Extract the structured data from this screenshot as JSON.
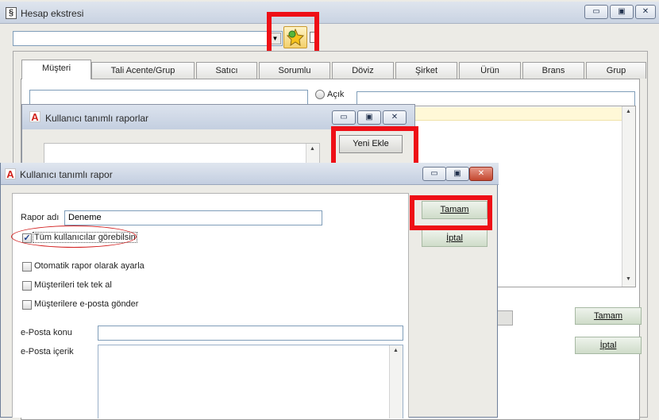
{
  "main_window": {
    "title": "Hesap ekstresi",
    "tabs": [
      "Müşteri",
      "Tali Acente/Grup",
      "Satıcı",
      "Sorumlu",
      "Döviz",
      "Şirket",
      "Ürün",
      "Brans",
      "Grup"
    ],
    "radio_label": "Açık",
    "ok_button": "Tamam",
    "cancel_button": "İptal"
  },
  "mid_dialog": {
    "title": "Kullanıcı tanımlı raporlar",
    "add_button": "Yeni Ekle"
  },
  "report_dialog": {
    "title": "Kullanıcı tanımlı rapor",
    "report_name_label": "Rapor adı",
    "report_name_value": "Deneme",
    "checkboxes": [
      {
        "label": "Tüm kullanıcılar görebilsin",
        "checked": true
      },
      {
        "label": "Otomatik rapor olarak ayarla",
        "checked": false
      },
      {
        "label": "Müşterileri tek tek al",
        "checked": false
      },
      {
        "label": "Müşterilere e-posta gönder",
        "checked": false
      }
    ],
    "email_subject_label": "e-Posta konu",
    "email_body_label": "e-Posta içerik",
    "ok_button": "Tamam",
    "cancel_button": "İptal"
  },
  "window_buttons": {
    "minimize": "▭",
    "maximize": "▣",
    "close": "✕"
  },
  "colors": {
    "highlight_red": "#ee0f16",
    "title_bar": "#c9d3e2",
    "list_highlight": "#fff8d7"
  }
}
